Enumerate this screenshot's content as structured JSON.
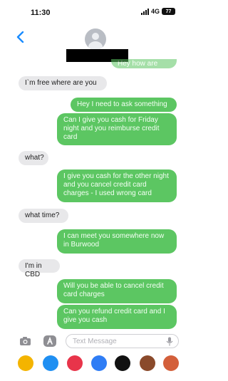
{
  "status": {
    "time": "11:30",
    "network": "4G",
    "battery": "77"
  },
  "thread": {
    "partially_visible_top": "Hey how are you",
    "messages": [
      {
        "direction": "incoming",
        "text": "I`m free where are you"
      },
      {
        "direction": "outgoing",
        "text": "Hey I need to ask something"
      },
      {
        "direction": "outgoing",
        "text": "Can I give you cash for Friday night and you reimburse credit card"
      },
      {
        "direction": "incoming",
        "text": "what?"
      },
      {
        "direction": "outgoing",
        "text": "I give you cash for the other night and you cancel credit card charges - I used wrong card"
      },
      {
        "direction": "incoming",
        "text": "what time?"
      },
      {
        "direction": "outgoing",
        "text": "I can meet you somewhere now in Burwood"
      },
      {
        "direction": "incoming",
        "text": "I'm in CBD"
      },
      {
        "direction": "outgoing",
        "text": "Will you be able to cancel credit card charges"
      },
      {
        "direction": "outgoing",
        "text": "Can you refund credit card and I give you cash"
      }
    ]
  },
  "composer": {
    "placeholder": "Text Message"
  },
  "app_tray": {
    "apps": [
      {
        "icon": "photos-icon",
        "color": "#f4b400"
      },
      {
        "icon": "app-store-icon",
        "color": "#1f8ff2"
      },
      {
        "icon": "search-images-icon",
        "color": "#e8344a"
      },
      {
        "icon": "digital-touch-icon",
        "color": "#2f7df5"
      },
      {
        "icon": "fitness-icon",
        "color": "#111111"
      },
      {
        "icon": "memoji-icon",
        "color": "#8a4a2b"
      },
      {
        "icon": "animoji-icon",
        "color": "#d35f3a"
      }
    ]
  },
  "colors": {
    "outgoing_bubble": "#5cc662",
    "incoming_bubble": "#e8e8ea",
    "accent": "#1a8cff"
  }
}
